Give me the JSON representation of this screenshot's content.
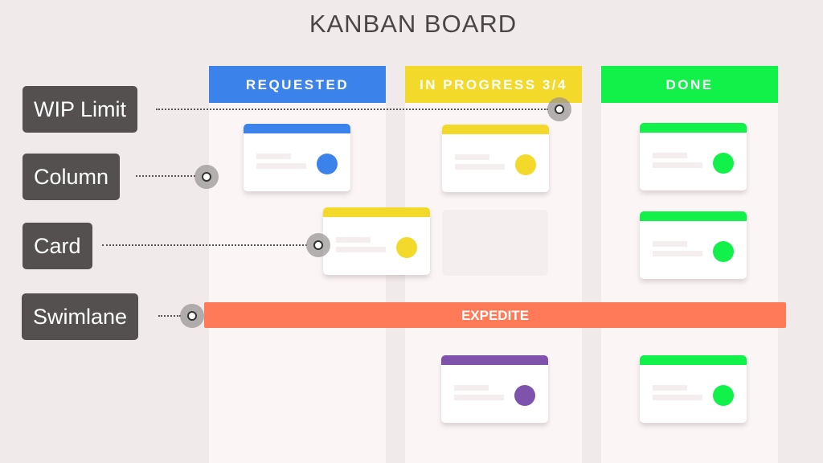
{
  "title": "KANBAN BOARD",
  "columns": [
    {
      "label": "REQUESTED",
      "color": "#3b82ea"
    },
    {
      "label": "IN PROGRESS 3/4",
      "color": "#f3da2a",
      "wip_current": 3,
      "wip_limit": 4
    },
    {
      "label": "DONE",
      "color": "#12f04a"
    }
  ],
  "cards": [
    {
      "column": "REQUESTED",
      "color": "#3b82ea"
    },
    {
      "column": "IN PROGRESS",
      "color": "#f3da2a"
    },
    {
      "column": "IN PROGRESS (dragging)",
      "color": "#f3da2a"
    },
    {
      "column": "DONE",
      "color": "#12f04a"
    },
    {
      "column": "DONE",
      "color": "#12f04a"
    },
    {
      "column": "IN PROGRESS (expedite)",
      "color": "#7f52ab"
    },
    {
      "column": "DONE (expedite)",
      "color": "#12f04a"
    }
  ],
  "swimlane": {
    "label": "EXPEDITE",
    "color": "#ff7a59"
  },
  "callouts": [
    {
      "label": "WIP Limit"
    },
    {
      "label": "Column"
    },
    {
      "label": "Card"
    },
    {
      "label": "Swimlane"
    }
  ]
}
